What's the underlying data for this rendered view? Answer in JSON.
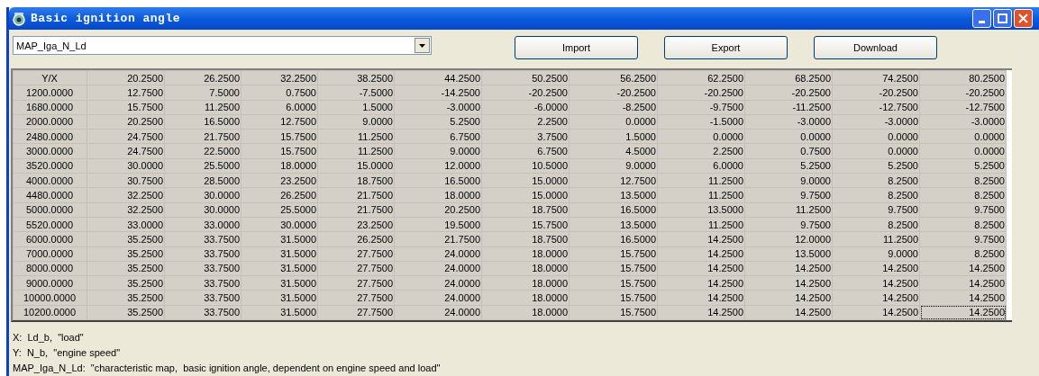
{
  "window": {
    "title": "Basic ignition angle"
  },
  "map_select": {
    "value": "MAP_Iga_N_Ld"
  },
  "buttons": [
    "Import",
    "Export",
    "Download"
  ],
  "table": {
    "corner": "Y/X",
    "columns": [
      "20.2500",
      "26.2500",
      "32.2500",
      "38.2500",
      "44.2500",
      "50.2500",
      "56.2500",
      "62.2500",
      "68.2500",
      "74.2500",
      "80.2500"
    ],
    "rows": [
      {
        "label": "1200.0000",
        "cells": [
          {
            "text": "12.7500",
            "selected": false
          },
          {
            "text": "7.5000",
            "selected": false
          },
          {
            "text": "0.7500",
            "selected": false
          },
          {
            "text": "-7.5000",
            "selected": false
          },
          {
            "text": "-14.2500",
            "selected": false
          },
          {
            "text": "-20.2500",
            "selected": false
          },
          {
            "text": "-20.2500",
            "selected": false
          },
          {
            "text": "-20.2500",
            "selected": false
          },
          {
            "text": "-20.2500",
            "selected": false
          },
          {
            "text": "-20.2500",
            "selected": false
          },
          {
            "text": "-20.2500",
            "selected": false
          }
        ]
      },
      {
        "label": "1680.0000",
        "cells": [
          {
            "text": "15.7500",
            "selected": false
          },
          {
            "text": "11.2500",
            "selected": false
          },
          {
            "text": "6.0000",
            "selected": false
          },
          {
            "text": "1.5000",
            "selected": false
          },
          {
            "text": "-3.0000",
            "selected": false
          },
          {
            "text": "-6.0000",
            "selected": false
          },
          {
            "text": "-8.2500",
            "selected": false
          },
          {
            "text": "-9.7500",
            "selected": false
          },
          {
            "text": "-11.2500",
            "selected": false
          },
          {
            "text": "-12.7500",
            "selected": false
          },
          {
            "text": "-12.7500",
            "selected": false
          }
        ]
      },
      {
        "label": "2000.0000",
        "cells": [
          {
            "text": "20.2500",
            "selected": false
          },
          {
            "text": "16.5000",
            "selected": false
          },
          {
            "text": "12.7500",
            "selected": false
          },
          {
            "text": "9.0000",
            "selected": false
          },
          {
            "text": "5.2500",
            "selected": false
          },
          {
            "text": "2.2500",
            "selected": false
          },
          {
            "text": "0.0000",
            "selected": false
          },
          {
            "text": "-1.5000",
            "selected": false
          },
          {
            "text": "-3.0000",
            "selected": false
          },
          {
            "text": "-3.0000",
            "selected": false
          },
          {
            "text": "-3.0000",
            "selected": false
          }
        ]
      },
      {
        "label": "2480.0000",
        "cells": [
          {
            "text": "24.7500",
            "selected": false
          },
          {
            "text": "21.7500",
            "selected": false
          },
          {
            "text": "15.7500",
            "selected": false
          },
          {
            "text": "11.2500",
            "selected": false
          },
          {
            "text": "6.7500",
            "selected": false
          },
          {
            "text": "3.7500",
            "selected": false
          },
          {
            "text": "1.5000",
            "selected": false
          },
          {
            "text": "0.0000",
            "selected": false
          },
          {
            "text": "0.0000",
            "selected": false
          },
          {
            "text": "0.0000",
            "selected": false
          },
          {
            "text": "0.0000",
            "selected": false
          }
        ]
      },
      {
        "label": "3000.0000",
        "cells": [
          {
            "text": "24.7500",
            "selected": false
          },
          {
            "text": "22.5000",
            "selected": false
          },
          {
            "text": "15.7500",
            "selected": false
          },
          {
            "text": "11.2500",
            "selected": false
          },
          {
            "text": "9.0000",
            "selected": false
          },
          {
            "text": "6.7500",
            "selected": false
          },
          {
            "text": "4.5000",
            "selected": false
          },
          {
            "text": "2.2500",
            "selected": false
          },
          {
            "text": "0.7500",
            "selected": false
          },
          {
            "text": "0.0000",
            "selected": false
          },
          {
            "text": "0.0000",
            "selected": false
          }
        ]
      },
      {
        "label": "3520.0000",
        "cells": [
          {
            "text": "30.0000",
            "selected": false
          },
          {
            "text": "25.5000",
            "selected": false
          },
          {
            "text": "18.0000",
            "selected": false
          },
          {
            "text": "15.0000",
            "selected": false
          },
          {
            "text": "12.0000",
            "selected": false
          },
          {
            "text": "10.5000",
            "selected": false
          },
          {
            "text": "9.0000",
            "selected": false
          },
          {
            "text": "6.0000",
            "selected": false
          },
          {
            "text": "5.2500",
            "selected": false
          },
          {
            "text": "5.2500",
            "selected": false
          },
          {
            "text": "5.2500",
            "selected": false
          }
        ]
      },
      {
        "label": "4000.0000",
        "cells": [
          {
            "text": "30.7500",
            "selected": false
          },
          {
            "text": "28.5000",
            "selected": false
          },
          {
            "text": "23.2500",
            "selected": false
          },
          {
            "text": "18.7500",
            "selected": false
          },
          {
            "text": "16.5000",
            "selected": false
          },
          {
            "text": "15.0000",
            "selected": false
          },
          {
            "text": "12.7500",
            "selected": false
          },
          {
            "text": "11.2500",
            "selected": false
          },
          {
            "text": "9.0000",
            "selected": false
          },
          {
            "text": "8.2500",
            "selected": false
          },
          {
            "text": "8.2500",
            "selected": false
          }
        ]
      },
      {
        "label": "4480.0000",
        "cells": [
          {
            "text": "32.2500",
            "selected": false
          },
          {
            "text": "30.0000",
            "selected": false
          },
          {
            "text": "26.2500",
            "selected": false
          },
          {
            "text": "21.7500",
            "selected": false
          },
          {
            "text": "18.0000",
            "selected": false
          },
          {
            "text": "15.0000",
            "selected": false
          },
          {
            "text": "13.5000",
            "selected": false
          },
          {
            "text": "11.2500",
            "selected": false
          },
          {
            "text": "9.7500",
            "selected": false
          },
          {
            "text": "8.2500",
            "selected": false
          },
          {
            "text": "8.2500",
            "selected": false
          }
        ]
      },
      {
        "label": "5000.0000",
        "cells": [
          {
            "text": "32.2500",
            "selected": false
          },
          {
            "text": "30.0000",
            "selected": false
          },
          {
            "text": "25.5000",
            "selected": false
          },
          {
            "text": "21.7500",
            "selected": false
          },
          {
            "text": "20.2500",
            "selected": false
          },
          {
            "text": "18.7500",
            "selected": false
          },
          {
            "text": "16.5000",
            "selected": false
          },
          {
            "text": "13.5000",
            "selected": false
          },
          {
            "text": "11.2500",
            "selected": false
          },
          {
            "text": "9.7500",
            "selected": false
          },
          {
            "text": "9.7500",
            "selected": false
          }
        ]
      },
      {
        "label": "5520.0000",
        "cells": [
          {
            "text": "33.0000",
            "selected": false
          },
          {
            "text": "33.0000",
            "selected": false
          },
          {
            "text": "30.0000",
            "selected": false
          },
          {
            "text": "23.2500",
            "selected": false
          },
          {
            "text": "19.5000",
            "selected": false
          },
          {
            "text": "15.7500",
            "selected": false
          },
          {
            "text": "13.5000",
            "selected": false
          },
          {
            "text": "11.2500",
            "selected": false
          },
          {
            "text": "9.7500",
            "selected": false
          },
          {
            "text": "8.2500",
            "selected": false
          },
          {
            "text": "8.2500",
            "selected": false
          }
        ]
      },
      {
        "label": "6000.0000",
        "cells": [
          {
            "text": "35.2500",
            "selected": false
          },
          {
            "text": "33.7500",
            "selected": false
          },
          {
            "text": "31.5000",
            "selected": false
          },
          {
            "text": "26.2500",
            "selected": false
          },
          {
            "text": "21.7500",
            "selected": false
          },
          {
            "text": "18.7500",
            "selected": false
          },
          {
            "text": "16.5000",
            "selected": false
          },
          {
            "text": "14.2500",
            "selected": false
          },
          {
            "text": "12.0000",
            "selected": false
          },
          {
            "text": "11.2500",
            "selected": false
          },
          {
            "text": "9.7500",
            "selected": false
          }
        ]
      },
      {
        "label": "7000.0000",
        "cells": [
          {
            "text": "35.2500",
            "selected": false
          },
          {
            "text": "33.7500",
            "selected": false
          },
          {
            "text": "31.5000",
            "selected": false
          },
          {
            "text": "27.7500",
            "selected": false
          },
          {
            "text": "24.0000",
            "selected": false
          },
          {
            "text": "18.0000",
            "selected": false
          },
          {
            "text": "15.7500",
            "selected": false
          },
          {
            "text": "14.2500",
            "selected": false
          },
          {
            "text": "13.5000",
            "selected": false
          },
          {
            "text": "9.0000",
            "selected": false
          },
          {
            "text": "8.2500",
            "selected": false
          }
        ]
      },
      {
        "label": "8000.0000",
        "cells": [
          {
            "text": "35.2500",
            "selected": false
          },
          {
            "text": "33.7500",
            "selected": false
          },
          {
            "text": "31.5000",
            "selected": false
          },
          {
            "text": "27.7500",
            "selected": false
          },
          {
            "text": "24.0000",
            "selected": false
          },
          {
            "text": "18.0000",
            "selected": false
          },
          {
            "text": "15.7500",
            "selected": false
          },
          {
            "text": "14.2500",
            "selected": false
          },
          {
            "text": "14.2500",
            "selected": false
          },
          {
            "text": "14.2500",
            "selected": false
          },
          {
            "text": "14.2500",
            "selected": false
          }
        ]
      },
      {
        "label": "9000.0000",
        "cells": [
          {
            "text": "35.2500",
            "selected": false
          },
          {
            "text": "33.7500",
            "selected": false
          },
          {
            "text": "31.5000",
            "selected": false
          },
          {
            "text": "27.7500",
            "selected": false
          },
          {
            "text": "24.0000",
            "selected": false
          },
          {
            "text": "18.0000",
            "selected": false
          },
          {
            "text": "15.7500",
            "selected": false
          },
          {
            "text": "14.2500",
            "selected": false
          },
          {
            "text": "14.2500",
            "selected": false
          },
          {
            "text": "14.2500",
            "selected": false
          },
          {
            "text": "14.2500",
            "selected": false
          }
        ]
      },
      {
        "label": "10000.0000",
        "cells": [
          {
            "text": "35.2500",
            "selected": false
          },
          {
            "text": "33.7500",
            "selected": false
          },
          {
            "text": "31.5000",
            "selected": false
          },
          {
            "text": "27.7500",
            "selected": false
          },
          {
            "text": "24.0000",
            "selected": false
          },
          {
            "text": "18.0000",
            "selected": false
          },
          {
            "text": "15.7500",
            "selected": false
          },
          {
            "text": "14.2500",
            "selected": false
          },
          {
            "text": "14.2500",
            "selected": false
          },
          {
            "text": "14.2500",
            "selected": false
          },
          {
            "text": "14.2500",
            "selected": false
          }
        ]
      },
      {
        "label": "10200.0000",
        "cells": [
          {
            "text": "35.2500",
            "selected": false
          },
          {
            "text": "33.7500",
            "selected": false
          },
          {
            "text": "31.5000",
            "selected": false
          },
          {
            "text": "27.7500",
            "selected": false
          },
          {
            "text": "24.0000",
            "selected": false
          },
          {
            "text": "18.0000",
            "selected": false
          },
          {
            "text": "15.7500",
            "selected": false
          },
          {
            "text": "14.2500",
            "selected": false
          },
          {
            "text": "14.2500",
            "selected": false
          },
          {
            "text": "14.2500",
            "selected": false
          },
          {
            "text": "14.2500",
            "selected": true
          }
        ]
      }
    ]
  },
  "notes": [
    "X:  Ld_b,  \"load\"",
    "Y:  N_b,  \"engine speed\"",
    "MAP_Iga_N_Ld:  \"characteristic map,  basic ignition angle, dependent on engine speed and load\""
  ]
}
